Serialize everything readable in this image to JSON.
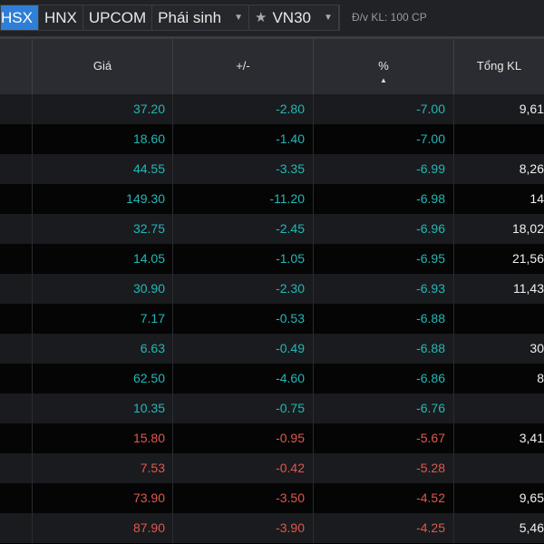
{
  "tabs": [
    "HSX",
    "HNX",
    "UPCOM",
    "Phái sinh",
    "VN30"
  ],
  "unit_label": "Đ/v KL: 100 CP",
  "columns": [
    "Giá",
    "+/-",
    "%",
    "Tổng KL"
  ],
  "colors": {
    "down": "#22b8b8",
    "decrease": "#e0574e",
    "active_tab": "#2f7fd6"
  },
  "rows": [
    {
      "price": "37.20",
      "change": "-2.80",
      "pct": "-7.00",
      "vol": "9,61",
      "tone": "down"
    },
    {
      "price": "18.60",
      "change": "-1.40",
      "pct": "-7.00",
      "vol": "",
      "tone": "down"
    },
    {
      "price": "44.55",
      "change": "-3.35",
      "pct": "-6.99",
      "vol": "8,26",
      "tone": "down"
    },
    {
      "price": "149.30",
      "change": "-11.20",
      "pct": "-6.98",
      "vol": "14",
      "tone": "down"
    },
    {
      "price": "32.75",
      "change": "-2.45",
      "pct": "-6.96",
      "vol": "18,02",
      "tone": "down"
    },
    {
      "price": "14.05",
      "change": "-1.05",
      "pct": "-6.95",
      "vol": "21,56",
      "tone": "down"
    },
    {
      "price": "30.90",
      "change": "-2.30",
      "pct": "-6.93",
      "vol": "11,43",
      "tone": "down"
    },
    {
      "price": "7.17",
      "change": "-0.53",
      "pct": "-6.88",
      "vol": "",
      "tone": "down"
    },
    {
      "price": "6.63",
      "change": "-0.49",
      "pct": "-6.88",
      "vol": "30",
      "tone": "down"
    },
    {
      "price": "62.50",
      "change": "-4.60",
      "pct": "-6.86",
      "vol": "8",
      "tone": "down"
    },
    {
      "price": "10.35",
      "change": "-0.75",
      "pct": "-6.76",
      "vol": "",
      "tone": "down"
    },
    {
      "price": "15.80",
      "change": "-0.95",
      "pct": "-5.67",
      "vol": "3,41",
      "tone": "red"
    },
    {
      "price": "7.53",
      "change": "-0.42",
      "pct": "-5.28",
      "vol": "",
      "tone": "red"
    },
    {
      "price": "73.90",
      "change": "-3.50",
      "pct": "-4.52",
      "vol": "9,65",
      "tone": "red"
    },
    {
      "price": "87.90",
      "change": "-3.90",
      "pct": "-4.25",
      "vol": "5,46",
      "tone": "red"
    }
  ]
}
